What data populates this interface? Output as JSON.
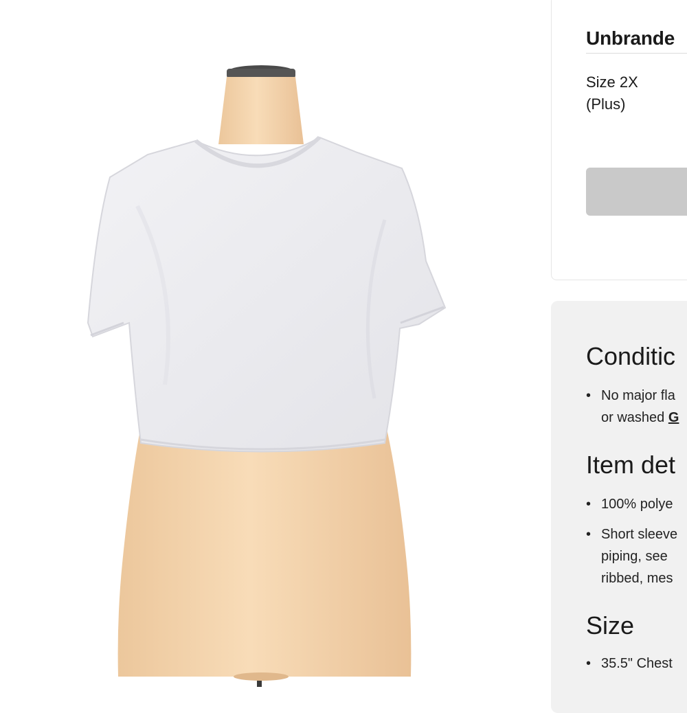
{
  "product": {
    "brand": "Unbrande",
    "size_line1": "Size 2X",
    "size_line2": "(Plus)"
  },
  "details": {
    "condition_heading": "Conditic",
    "condition_bullet_line1": "No major fla",
    "condition_bullet_line2a": "or washed ",
    "condition_bullet_line2b": "G",
    "item_heading": "Item det",
    "item_bullet1": "100% polye",
    "item_bullet2_line1": "Short sleeve",
    "item_bullet2_line2": "piping, see",
    "item_bullet2_line3": "ribbed, mes",
    "size_heading": "Size",
    "size_bullet1": "35.5\" Chest"
  },
  "colors": {
    "button_grey": "#c9c9c9",
    "panel_bg": "#f1f1f1",
    "shirt": "#ededf0",
    "mannequin": "#f3d3ad"
  }
}
